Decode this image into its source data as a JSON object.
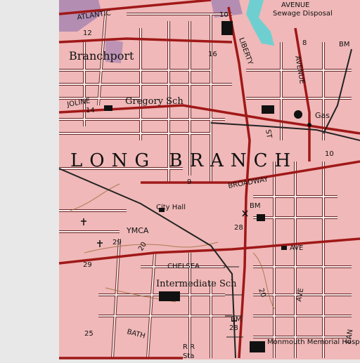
{
  "colors": {
    "margin": "#e8e8e8",
    "urban_tint": "#f0b8b8",
    "major_road": "#a01818",
    "minor_road": "#f8e8e8",
    "street_edge": "#6b2a2a",
    "water": "#6fcfd0",
    "park": "#9a7ab0",
    "railroad": "#222222",
    "contour": "#a06a3a",
    "text": "#111111"
  },
  "labels": {
    "city": "LONG BRANCH",
    "place_branchport": "Branchport",
    "school_gregory": "Gregory Sch",
    "school_intermediate": "Intermediate Sch",
    "hospital": "Monmouth Memorial Hospital",
    "city_hall": "City Hall",
    "ymca": "YMCA",
    "gas": "Gas",
    "sewage": "Sewage Disposal"
  },
  "streets": {
    "atlantic": "ATLANTIC",
    "joline": "JOLINE",
    "liberty": "LIBERTY",
    "st": "ST",
    "avenue": "AVENUE",
    "broadway": "BROADWAY",
    "chelsea": "CHELSEA",
    "ave": "AVE",
    "ave2": "AVE",
    "bath": "BATH",
    "avenue_top": "AVENUE",
    "ave_right": "AVE",
    "ean": "EAN"
  },
  "marks": {
    "bm_top": "BM",
    "bm_mid": "BM",
    "bm_low": "BM",
    "num_10": "10",
    "num_12": "12",
    "num_8": "8",
    "num_16": "16",
    "num_14": "14",
    "num_10b": "10",
    "num_28": "28",
    "num_29": "29",
    "num_29b": "29",
    "num_28b": "28",
    "num_25": "25",
    "num_20": "20",
    "num_20b": "20",
    "num_9": "9",
    "rr": "R R",
    "sta": "Sta"
  },
  "icons": [
    "school-marker",
    "church-cross",
    "tank-marker",
    "benchmark-marker",
    "building-block"
  ]
}
